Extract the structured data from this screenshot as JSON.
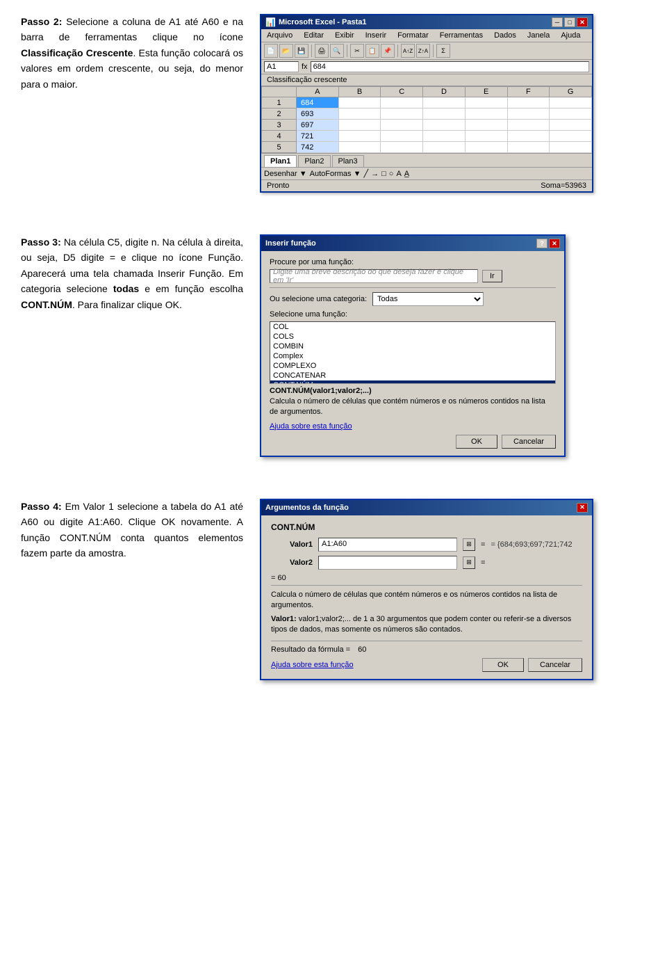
{
  "section1": {
    "text_parts": [
      {
        "type": "bold",
        "text": "Passo 2:"
      },
      {
        "type": "normal",
        "text": " Selecione a coluna de A1 até A60 e na barra de ferramentas clique no ícone "
      },
      {
        "type": "bold",
        "text": "Classificação Crescente"
      },
      {
        "type": "normal",
        "text": ". Esta função colocará os valores em ordem crescente, ou seja, do menor para o maior."
      }
    ],
    "excel": {
      "title": "Microsoft Excel - Pasta1",
      "menu_items": [
        "Arquivo",
        "Editar",
        "Exibir",
        "Inserir",
        "Formatar",
        "Ferramentas",
        "Dados",
        "Janela",
        "Ajuda"
      ],
      "name_box": "A1",
      "formula": "684",
      "sort_banner": "Classificação crescente",
      "columns": [
        "",
        "A",
        "B",
        "C",
        "D",
        "E",
        "F",
        "G"
      ],
      "rows": [
        {
          "num": "1",
          "a": "684",
          "selected": true
        },
        {
          "num": "2",
          "a": "693"
        },
        {
          "num": "3",
          "a": "697"
        },
        {
          "num": "4",
          "a": "721"
        },
        {
          "num": "5",
          "a": "742"
        }
      ],
      "sheets": [
        "Plan1",
        "Plan2",
        "Plan3"
      ],
      "active_sheet": "Plan1",
      "status_left": "Pronto",
      "status_right": "Soma=53963",
      "drawing_bar_items": [
        "Desenhar ▼",
        "AutoFormas ▼"
      ]
    }
  },
  "section2": {
    "text_parts": [
      {
        "type": "bold",
        "text": "Passo 3:"
      },
      {
        "type": "normal",
        "text": " Na célula C5, digite n. Na célula à direita, ou seja, D5 digite = e clique no ícone Função. Aparecerá uma tela chamada Inserir Função. Em categoria selecione "
      },
      {
        "type": "bold",
        "text": "todas"
      },
      {
        "type": "normal",
        "text": " e em função escolha "
      },
      {
        "type": "bold",
        "text": "CONT.NÚM"
      },
      {
        "type": "normal",
        "text": ". Para finalizar clique OK."
      }
    ],
    "dialog": {
      "title": "Inserir função",
      "search_label": "Procure por uma função:",
      "search_placeholder": "Digite uma breve descrição do que deseja fazer e clique em 'Ir'",
      "ir_btn": "Ir",
      "category_label": "Ou selecione uma categoria:",
      "category_value": "Todas",
      "function_label": "Selecione uma função:",
      "functions": [
        "COL",
        "COLS",
        "COMBIN",
        "Complex",
        "COMPLEXO",
        "CONCATENAR",
        "CONT.NÚM"
      ],
      "selected_function": "CONT.NÚM",
      "signature": "CONT.NÚM(valor1;valor2;...)",
      "description": "Calcula o número de células que contém números e os números contidos na lista de argumentos.",
      "help_link": "Ajuda sobre esta função",
      "ok_btn": "OK",
      "cancel_btn": "Cancelar"
    }
  },
  "section3": {
    "text_parts": [
      {
        "type": "bold",
        "text": "Passo 4:"
      },
      {
        "type": "normal",
        "text": " Em Valor 1 selecione a tabela do A1 até A60 ou digite A1:A60. Clique OK novamente. A função CONT.NÚM conta quantos elementos fazem parte da amostra."
      }
    ],
    "dialog": {
      "title": "Argumentos da função",
      "func_name": "CONT.NÚM",
      "valor1_label": "Valor1",
      "valor1_value": "A1:A60",
      "valor1_result": "= {684;693;697;721;742",
      "valor2_label": "Valor2",
      "valor2_value": "",
      "valor2_result": "=",
      "total_result": "= 60",
      "desc_main": "Calcula o número de células que contém números e os números contidos na lista de argumentos.",
      "desc_arg": "Valor1: valor1;valor2;... de 1 a 30 argumentos que podem conter ou referir-se a diversos tipos de dados, mas somente os números são contados.",
      "resultado_label": "Resultado da fórmula =",
      "resultado_value": "60",
      "help_link": "Ajuda sobre esta função",
      "ok_btn": "OK",
      "cancel_btn": "Cancelar"
    }
  },
  "icons": {
    "minimize": "─",
    "maximize": "□",
    "close": "✕",
    "help": "?",
    "dropdown": "▼"
  }
}
